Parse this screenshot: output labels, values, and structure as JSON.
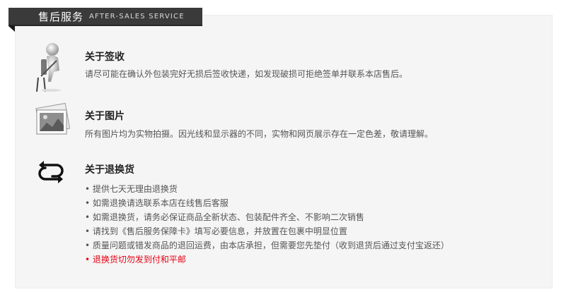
{
  "header": {
    "title": "售后服务",
    "subtitle": "AFTER-SALES SERVICE"
  },
  "sections": [
    {
      "title": "关于签收",
      "description": "请尽可能在确认外包装完好无损后签收快递，如发现破损可拒绝签单并联系本店售后。",
      "icon": "person-signing-icon"
    },
    {
      "title": "关于图片",
      "description": "所有图片均为实物拍摄。因光线和显示器的不同，实物和网页展示存在一定色差，敬请理解。",
      "icon": "photo-icon"
    },
    {
      "title": "关于退换货",
      "icon": "exchange-arrows-icon",
      "items": [
        "• 提供七天无理由退换货",
        "• 如需退换请选联系本店在线售后客服",
        "• 如需退换货，请务必保证商品全新状态、包装配件齐全、不影响二次销售",
        "• 请找到《售后服务保障卡》填写必要信息，并放置在包裹中明显位置",
        "• 质量问题或错发商品的退回运费，由本店承担，但需要您先垫付（收到退货后通过支付宝返还）",
        "• 退换货切勿发到付和平邮"
      ]
    }
  ],
  "colors": {
    "header_bg": "#3a3a3a",
    "panel_bg": "#f5f5f5",
    "text": "#555555",
    "warning": "#e60012"
  }
}
